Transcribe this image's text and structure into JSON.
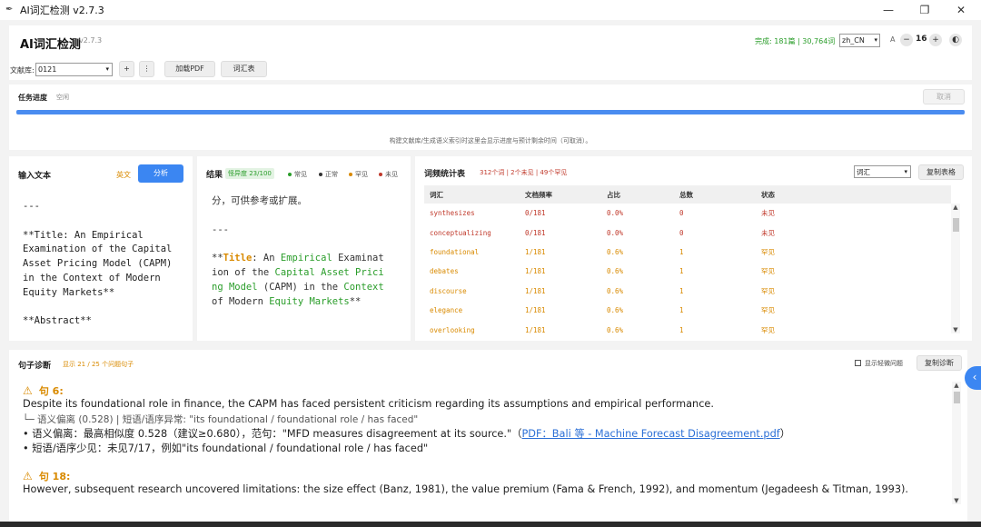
{
  "window": {
    "title": "AI词汇检测 v2.7.3",
    "min": "—",
    "max": "❐",
    "close": "✕"
  },
  "header": {
    "brand": "AI词汇检测",
    "version": "v2.7.3",
    "status": "完成: 181篇 | 30,764词",
    "locale": "zh_CN",
    "font_label": "A",
    "font_size": "16",
    "minus": "−",
    "plus": "+",
    "theme": "◐"
  },
  "toolbar": {
    "corpus_label": "文献库:",
    "corpus_value": "0121",
    "add": "+",
    "more": "⋮",
    "load_pdf": "加载PDF",
    "vocab": "词汇表"
  },
  "task": {
    "label": "任务进度",
    "state": "空闲",
    "cancel": "取消",
    "progress": 1.0,
    "hint": "构建文献库/生成语义索引时这里会显示进度与预计剩余时间（可取消）。"
  },
  "input_panel": {
    "title": "输入文本",
    "lang": "英文",
    "analyze": "分析",
    "text": "---\n\n**Title: An Empirical Examination of the Capital Asset Pricing Model (CAPM) in the Context of Modern Equity Markets**\n\n**Abstract**"
  },
  "result_panel": {
    "title": "结果",
    "badge": "怪异度 23/100",
    "legend": [
      "常见",
      "正常",
      "罕见",
      "未见"
    ],
    "top_line": "分，可供参考或扩展。",
    "divider": "---",
    "stars_open": "**",
    "title_word": "Title",
    "colon": ": An ",
    "w1": "Empirical",
    "t1": " Examinat\nion of the ",
    "w2": "Capital Asset Prici\nng Model",
    "t2": " (CAPM) in the ",
    "w3": "Context",
    "t3": "\nof Modern ",
    "w4": "Equity Markets",
    "stars_close": "**"
  },
  "freq_panel": {
    "title": "词频统计表",
    "summary": "312个词 | 2个未见 | 49个罕见",
    "filter": "词汇",
    "copy": "复制表格",
    "columns": [
      "词汇",
      "文档频率",
      "占比",
      "总数",
      "状态"
    ],
    "rows": [
      {
        "word": "synthesizes",
        "df": "0/181",
        "pct": "0.0%",
        "total": "0",
        "status": "未见"
      },
      {
        "word": "conceptualizing",
        "df": "0/181",
        "pct": "0.0%",
        "total": "0",
        "status": "未见"
      },
      {
        "word": "foundational",
        "df": "1/181",
        "pct": "0.6%",
        "total": "1",
        "status": "罕见"
      },
      {
        "word": "debates",
        "df": "1/181",
        "pct": "0.6%",
        "total": "1",
        "status": "罕见"
      },
      {
        "word": "discourse",
        "df": "1/181",
        "pct": "0.6%",
        "total": "1",
        "status": "罕见"
      },
      {
        "word": "elegance",
        "df": "1/181",
        "pct": "0.6%",
        "total": "1",
        "status": "罕见"
      },
      {
        "word": "overlooking",
        "df": "1/181",
        "pct": "0.6%",
        "total": "1",
        "status": "罕见"
      }
    ]
  },
  "diagnosis": {
    "title": "句子诊断",
    "count": "显示 21 / 25 个问题句子",
    "show_minor": "显示轻微问题",
    "copy": "复制诊断",
    "entries": [
      {
        "head": "句 6:",
        "sentence": "Despite its foundational role in finance, the CAPM has faced persistent criticism regarding its assumptions and empirical performance.",
        "detail": "└─ 语义偏离 (0.528) | 短语/语序异常: \"its foundational / foundational role / has faced\"",
        "b1_pre": "• 语义偏离：最高相似度 0.528（建议≥0.680），范句：\"MFD measures disagreement at its source.\"（",
        "b1_link": "PDF：Bali 等 - Machine Forecast Disagreement.pdf",
        "b1_post": "）",
        "b2": "• 短语/语序少见：未见7/17，例如\"its foundational / foundational role / has faced\""
      },
      {
        "head": "句 18:",
        "sentence": "However, subsequent research uncovered limitations: the size effect (Banz, 1981), the value premium (Fama & French, 1992), and momentum (Jegadeesh & Titman, 1993)."
      }
    ]
  },
  "colors": {
    "accent": "#3b86f2",
    "rare": "#d98a00",
    "unseen": "#c0392b",
    "ok": "#2a9d2a"
  }
}
